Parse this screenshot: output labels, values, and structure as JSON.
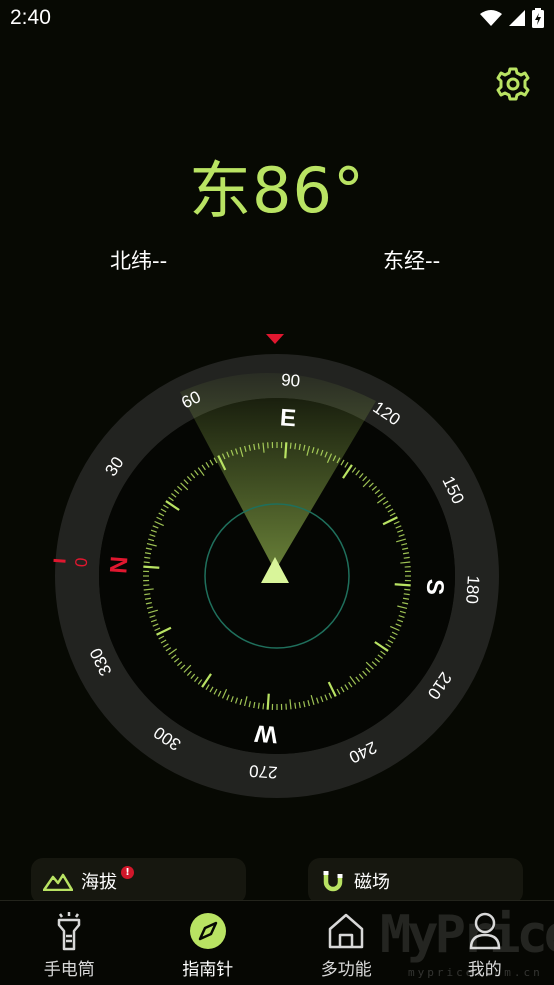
{
  "status_bar": {
    "time": "2:40"
  },
  "heading": {
    "direction_text": "东86°",
    "heading_deg": 86
  },
  "location": {
    "latitude": "北纬--",
    "longitude": "东经--"
  },
  "compass": {
    "cardinals": {
      "north": "N",
      "east": "E",
      "south": "S",
      "west": "W"
    },
    "degree_labels": [
      "0",
      "30",
      "60",
      "90",
      "120",
      "150",
      "180",
      "210",
      "240",
      "270",
      "300",
      "330"
    ],
    "colors": {
      "accent": "#b9e363",
      "north": "#e0172f",
      "ring": "#1f201c"
    }
  },
  "cards": {
    "altitude": {
      "label": "海拔",
      "badge": "!"
    },
    "magnetic": {
      "label": "磁场"
    }
  },
  "nav": {
    "items": [
      {
        "label": "手电筒",
        "icon": "flashlight-icon",
        "active": false
      },
      {
        "label": "指南针",
        "icon": "compass-icon",
        "active": true
      },
      {
        "label": "多功能",
        "icon": "home-icon",
        "active": false
      },
      {
        "label": "我的",
        "icon": "person-icon",
        "active": false
      }
    ]
  },
  "watermark": {
    "main": "MyPrice",
    "sub": "myprice.com.cn"
  }
}
